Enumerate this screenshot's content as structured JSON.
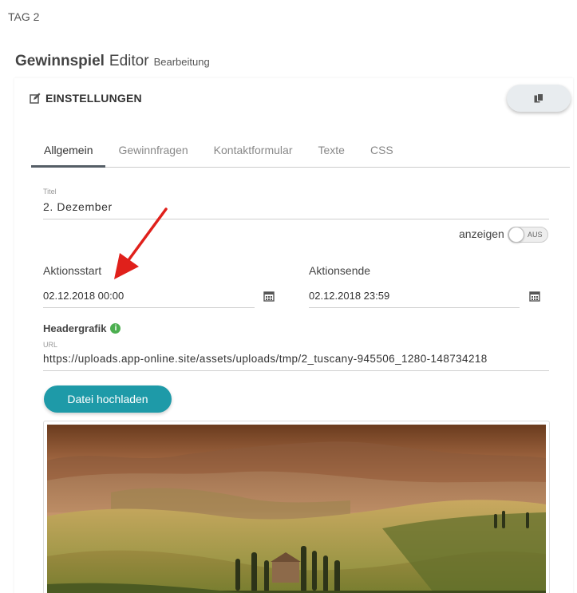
{
  "top_tag": "TAG 2",
  "page_title": {
    "part1": "Gewinnspiel",
    "part2": "Editor",
    "part3": "Bearbeitung"
  },
  "panel": {
    "title": "EINSTELLUNGEN",
    "copy_icon": "copy-icon",
    "edit_icon": "edit-icon"
  },
  "tabs": [
    "Allgemein",
    "Gewinnfragen",
    "Kontaktformular",
    "Texte",
    "CSS"
  ],
  "active_tab": "Allgemein",
  "title_field": {
    "label": "Titel",
    "value": "2. Dezember"
  },
  "toggle": {
    "label": "anzeigen",
    "state_text": "AUS"
  },
  "aktionsstart": {
    "label": "Aktionsstart",
    "value": "02.12.2018 00:00",
    "icon": "calendar-icon"
  },
  "aktionsende": {
    "label": "Aktionsende",
    "value": "02.12.2018 23:59",
    "icon": "calendar-icon"
  },
  "headergrafik": {
    "label": "Headergrafik",
    "info_icon": "i",
    "url_label": "URL",
    "url_value": "https://uploads.app-online.site/assets/uploads/tmp/2_tuscany-945506_1280-148734218"
  },
  "upload_button": "Datei hochladen",
  "colors": {
    "accent": "#1e9aa8",
    "annotation_arrow": "#e0201b",
    "info_green": "#4caf50"
  }
}
